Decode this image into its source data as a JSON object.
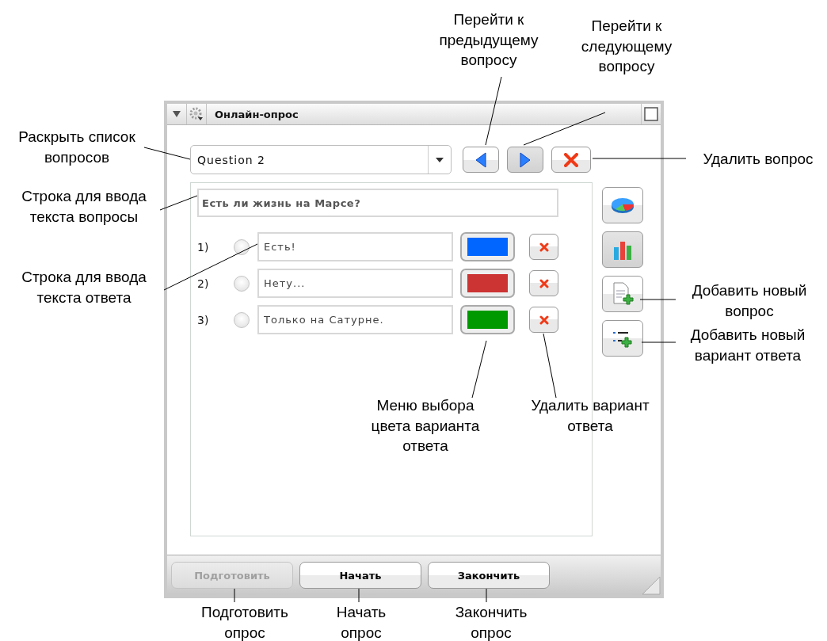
{
  "panel": {
    "title": "Онлайн-опрос"
  },
  "question_select": {
    "value": "Question 2"
  },
  "nav_buttons": [
    {
      "kind": "prev",
      "pressed": false
    },
    {
      "kind": "next",
      "pressed": true
    },
    {
      "kind": "delete",
      "pressed": false
    }
  ],
  "question_text": {
    "value": "Есть ли жизнь на Марсе?"
  },
  "answers": [
    {
      "number": "1)",
      "text": "Есть!",
      "color": "#0066ff",
      "selected": false
    },
    {
      "number": "2)",
      "text": "Нету...",
      "color": "#cc3333",
      "selected": false
    },
    {
      "number": "3)",
      "text": "Только на Сатурне.",
      "color": "#009900",
      "selected": false
    }
  ],
  "side_tools": [
    {
      "kind": "pie",
      "pressed": false
    },
    {
      "kind": "bar",
      "pressed": true
    },
    {
      "kind": "add-question",
      "pressed": false
    },
    {
      "kind": "add-answer",
      "pressed": false
    }
  ],
  "footer_buttons": [
    {
      "label": "Подготовить",
      "disabled": true
    },
    {
      "label": "Начать",
      "disabled": false
    },
    {
      "label": "Закончить",
      "disabled": false
    }
  ],
  "callouts": [
    {
      "lines": [
        "Перейти к",
        "предыдущему",
        "вопросу"
      ]
    },
    {
      "lines": [
        "Перейти к",
        "следующему",
        "вопросу"
      ]
    },
    {
      "lines": [
        "Раскрыть список",
        "вопросов"
      ]
    },
    {
      "lines": [
        "Удалить вопрос"
      ]
    },
    {
      "lines": [
        "Строка для ввода",
        "текста вопросы"
      ]
    },
    {
      "lines": [
        "Строка для ввода",
        "текста ответа"
      ]
    },
    {
      "lines": [
        "Добавить новый",
        "вопрос"
      ]
    },
    {
      "lines": [
        "Добавить новый",
        "вариант ответа"
      ]
    },
    {
      "lines": [
        "Меню выбора",
        "цвета варианта",
        "ответа"
      ]
    },
    {
      "lines": [
        "Удалить вариант",
        "ответа"
      ]
    },
    {
      "lines": [
        "Подготовить",
        "опрос"
      ]
    },
    {
      "lines": [
        "Начать",
        "опрос"
      ]
    },
    {
      "lines": [
        "Закончить",
        "опрос"
      ]
    }
  ]
}
